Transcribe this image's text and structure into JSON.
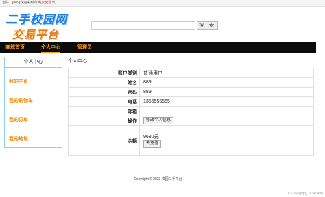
{
  "topbar": {
    "welcome": "您好！[889]欢迎来到商城",
    "logout": "[安全退出]"
  },
  "logo": {
    "line1": "二手校园网",
    "line2": "交易平台"
  },
  "search": {
    "value": "",
    "placeholder": "",
    "button_label": "搜 索"
  },
  "nav": {
    "items": [
      {
        "label": "商城首页"
      },
      {
        "label": "个人中心"
      },
      {
        "label": "管理员"
      }
    ]
  },
  "sidebar": {
    "title": "个人中心",
    "links": [
      {
        "label": "我的主页"
      },
      {
        "label": "我的购物车"
      },
      {
        "label": "我的订单"
      },
      {
        "label": "我的地址"
      }
    ]
  },
  "panel": {
    "title": "个人中心",
    "rows": [
      {
        "key": "账户类别",
        "value": "普通用户"
      },
      {
        "key": "姓名",
        "value": "889"
      },
      {
        "key": "密码",
        "value": "889"
      },
      {
        "key": "电话",
        "value": "1355555555"
      },
      {
        "key": "邮箱",
        "value": ""
      },
      {
        "key": "操作",
        "button": "修改个人信息"
      },
      {
        "key": "余额",
        "value": "9680元",
        "button": "去充值"
      }
    ]
  },
  "footer": {
    "copyright": "Copyright © 2023 校园二手平台"
  },
  "watermark": "CSDN @qq_18340498"
}
